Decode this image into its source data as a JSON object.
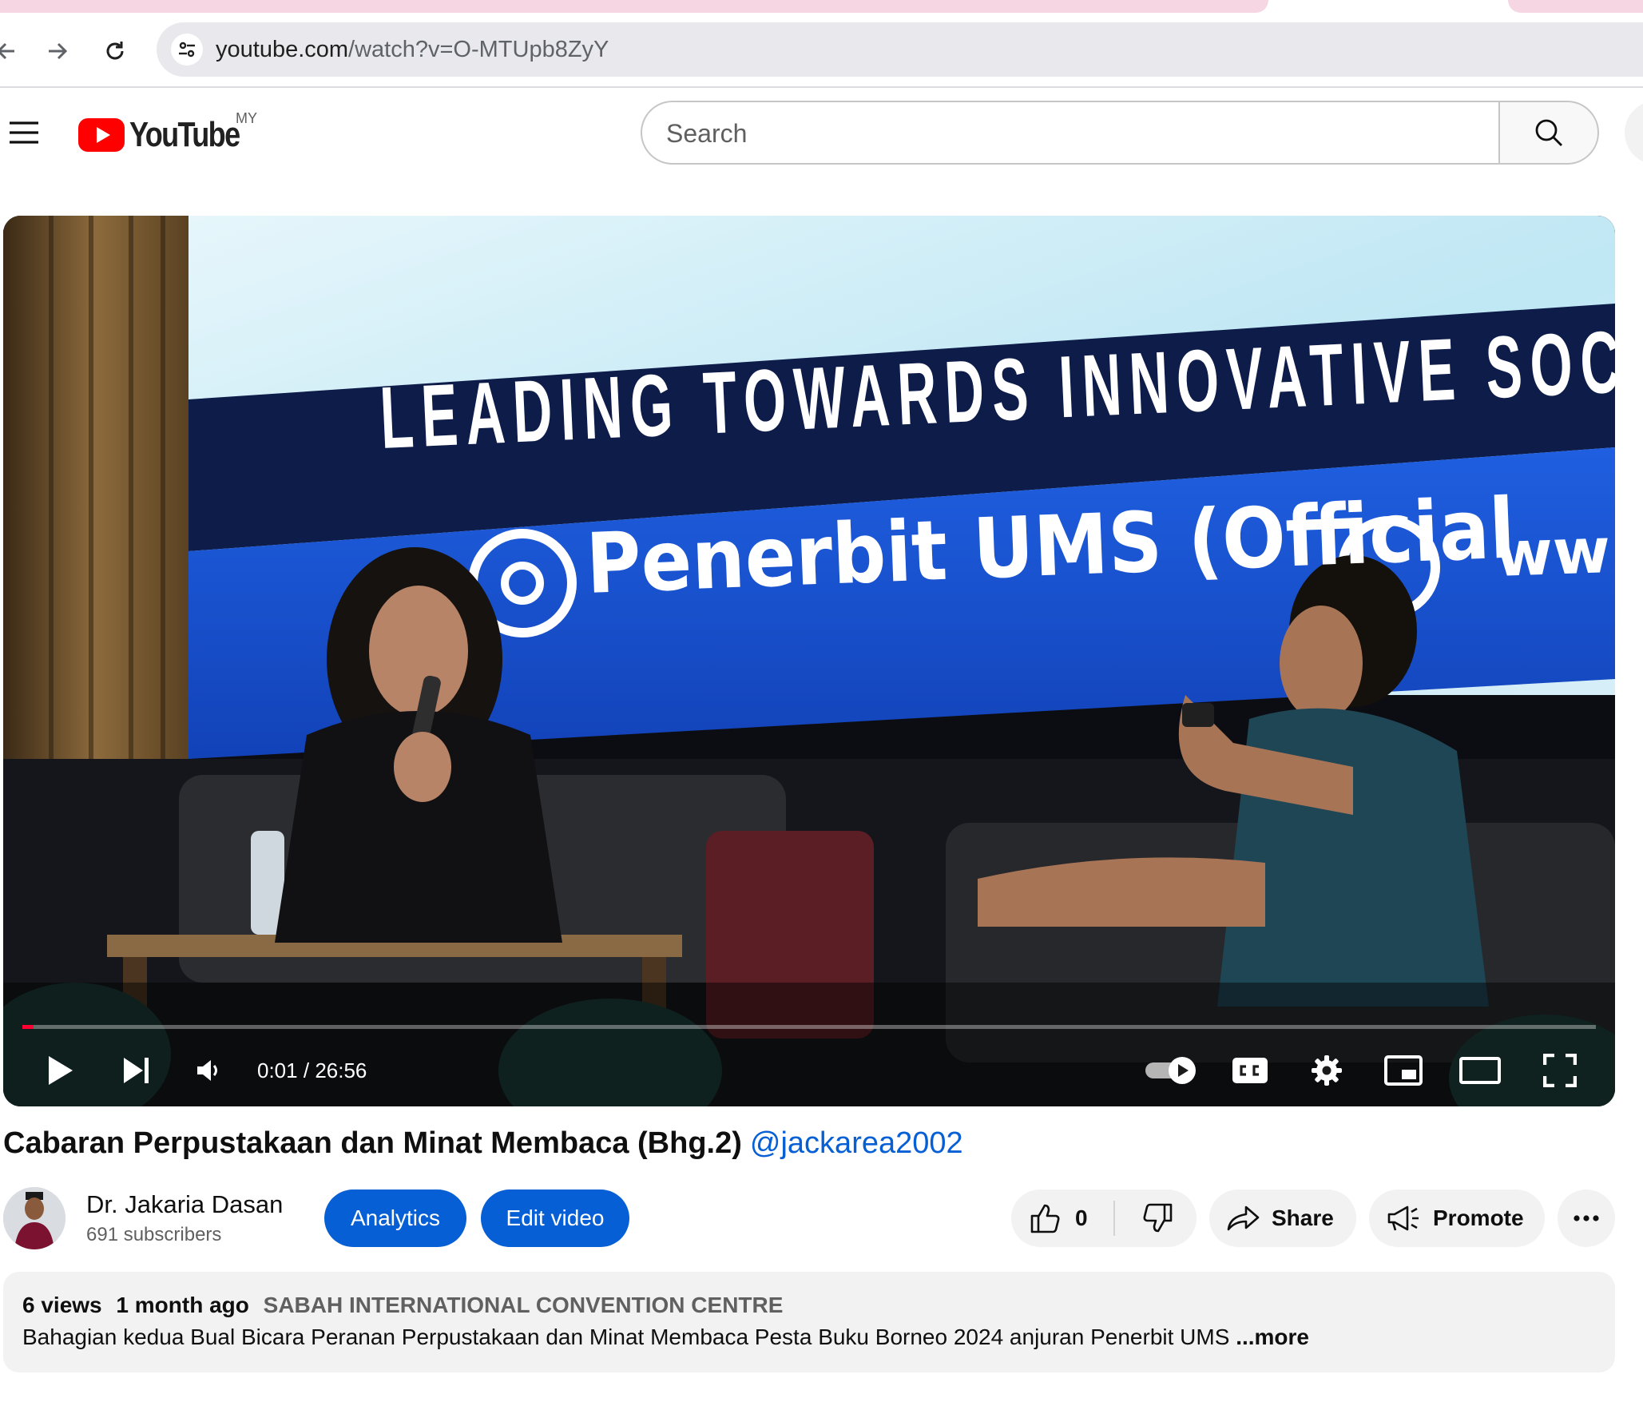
{
  "browser": {
    "url_host": "youtube.com",
    "url_path": "/watch?v=O-MTUpb8ZyY"
  },
  "masthead": {
    "logo_word": "YouTube",
    "region": "MY",
    "search_placeholder": "Search"
  },
  "player": {
    "scene_banner_white": "LEADING TOWARDS INNOVATIVE SOCIE",
    "scene_banner_blue": "Penerbit UMS (Official",
    "scene_banner_www": "ww",
    "current_time": "0:01",
    "separator": "/",
    "duration": "26:56",
    "progress_fraction": 0.0006,
    "autoplay_on": true
  },
  "video": {
    "title": "Cabaran Perpustakaan dan Minat Membaca (Bhg.2)",
    "title_tag": "@jackarea2002"
  },
  "channel": {
    "name": "Dr. Jakaria Dasan",
    "subscribers": "691 subscribers"
  },
  "actions": {
    "analytics": "Analytics",
    "edit_video": "Edit video",
    "like_count": "0",
    "share": "Share",
    "promote": "Promote"
  },
  "description": {
    "views": "6 views",
    "age": "1 month ago",
    "location": "SABAH INTERNATIONAL CONVENTION CENTRE",
    "text": "Bahagian kedua Bual Bicara Peranan Perpustakaan dan Minat Membaca Pesta Buku Borneo 2024 anjuran Penerbit UMS",
    "more": "...more"
  },
  "colors": {
    "brand_red": "#ff0000",
    "link_blue": "#065fd4",
    "progress_red": "#ff0033"
  }
}
